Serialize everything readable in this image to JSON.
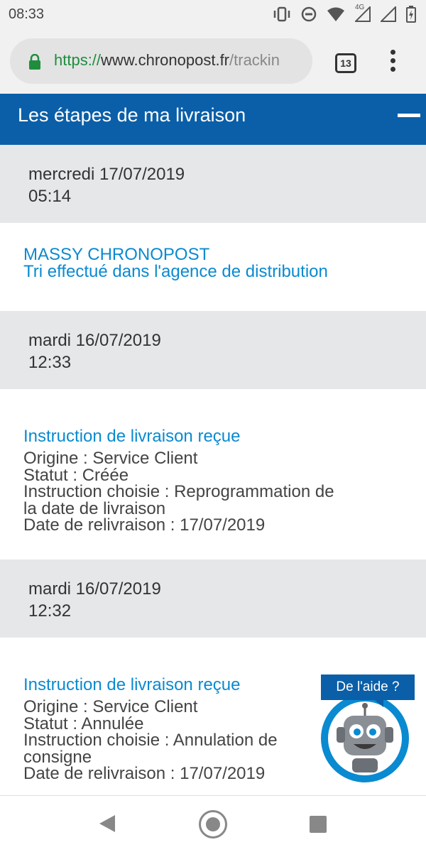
{
  "status_bar": {
    "time": "08:33",
    "network_label": "4G",
    "icons": [
      "vibrate-icon",
      "do-not-disturb-icon",
      "wifi-icon",
      "signal-icon",
      "battery-icon"
    ]
  },
  "browser": {
    "url_scheme": "https://",
    "url_host": "www.chronopost.fr",
    "url_path": "/trackin",
    "tab_count": "13"
  },
  "section": {
    "title": "Les étapes de ma livraison"
  },
  "events": [
    {
      "date": "mercredi 17/07/2019",
      "time": "05:14",
      "title_lines": [
        "MASSY CHRONOPOST",
        "Tri effectué dans l'agence de distribution"
      ],
      "details": []
    },
    {
      "date": "mardi 16/07/2019",
      "time": "12:33",
      "title_lines": [
        "Instruction de livraison reçue"
      ],
      "details": [
        "Origine : Service Client",
        "Statut : Créée",
        "Instruction choisie : Reprogrammation de",
        "la date de livraison",
        "Date de relivraison : 17/07/2019"
      ]
    },
    {
      "date": "mardi 16/07/2019",
      "time": "12:32",
      "title_lines": [
        "Instruction de livraison reçue"
      ],
      "details": [
        "Origine : Service Client",
        "Statut : Annulée",
        "Instruction choisie : Annulation de",
        "consigne",
        "Date de relivraison : 17/07/2019"
      ]
    }
  ],
  "help": {
    "label": "De l'aide ?"
  },
  "colors": {
    "brand_blue": "#0a5fa8",
    "link_blue": "#0a8ad0",
    "date_bg": "#e6e7e8"
  }
}
